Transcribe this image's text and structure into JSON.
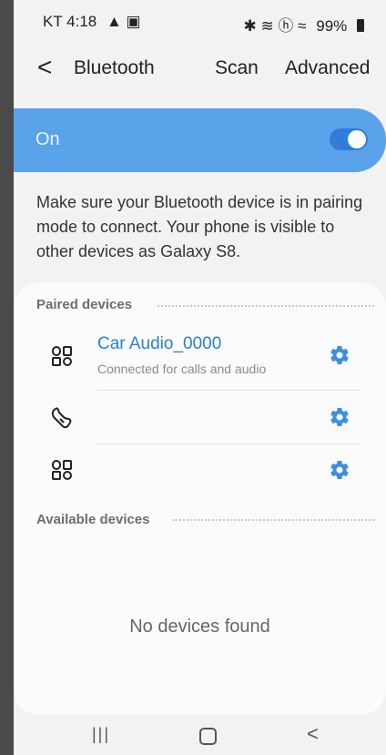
{
  "status_bar": {
    "carrier_time": "KT 4:18",
    "notif_icons": "▲ ▣",
    "right_icons": "✱ ≋ ⓗ ≈",
    "battery": "99%"
  },
  "app_bar": {
    "back_glyph": "<",
    "title": "Bluetooth",
    "scan_label": "Scan",
    "advanced_label": "Advanced"
  },
  "bluetooth": {
    "state_label": "On",
    "enabled": true
  },
  "description": "Make sure your Bluetooth device is in pairing mode to connect. Your phone is visible to other devices as Galaxy S8.",
  "paired": {
    "header": "Paired devices",
    "devices": [
      {
        "icon": "device-generic-icon",
        "name": "Car Audio_0000",
        "status": "Connected for calls and audio"
      },
      {
        "icon": "headset-icon",
        "name": "",
        "status": ""
      },
      {
        "icon": "device-generic-icon",
        "name": "",
        "status": ""
      }
    ]
  },
  "available": {
    "header": "Available devices",
    "empty_text": "No devices found"
  },
  "nav": {
    "recent_glyph": "|||",
    "back_glyph": "<"
  },
  "colors": {
    "accent": "#2b7fd4",
    "on_bar": "#5aa2ea",
    "gear": "#3d8fdc"
  }
}
